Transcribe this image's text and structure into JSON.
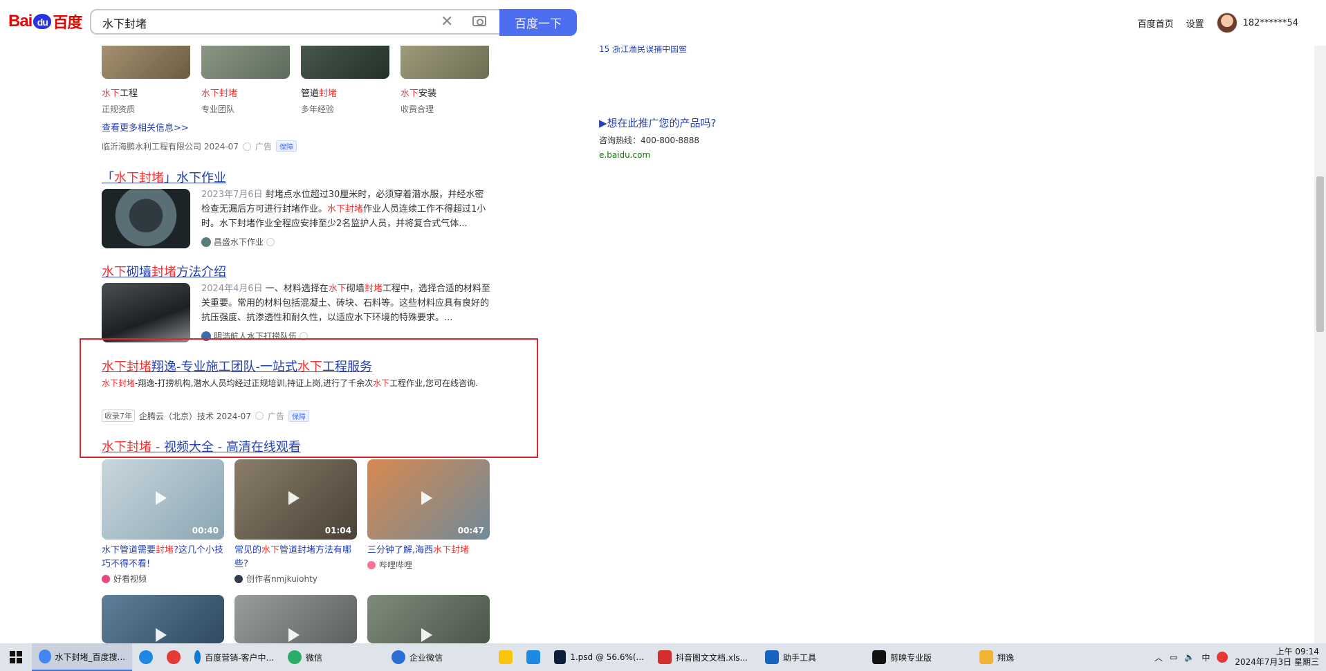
{
  "header": {
    "logo_bai": "Bai",
    "logo_du": "du",
    "logo_cn": "百度",
    "search_value": "水下封堵",
    "search_button": "百度一下",
    "links": [
      "百度首页",
      "设置"
    ],
    "username": "182******54"
  },
  "image_tiles": [
    {
      "title_red": "水下",
      "title_rest": "工程",
      "sub": "正规资质",
      "color": "#8a7a5c"
    },
    {
      "title_red": "水下封堵",
      "title_rest": "",
      "sub": "专业团队",
      "color": "#7e8a78"
    },
    {
      "title_pre": "管道",
      "title_red": "封堵",
      "title_rest": "",
      "sub": "多年经验",
      "color": "#3c4a40"
    },
    {
      "title_red": "水下",
      "title_rest": "安装",
      "sub": "收费合理",
      "color": "#8c8a6a"
    }
  ],
  "more_link": "查看更多相关信息>>",
  "ad1_source": {
    "company": "临沂海鹏水利工程有限公司 2024-07",
    "ad": "广告",
    "badge": "保障"
  },
  "result1": {
    "title_pre": "「",
    "title_red": "水下封堵",
    "title_post": "」水下作业",
    "date": "2023年7月6日",
    "text_a": " 封堵点水位超过30厘米时，必须穿着潜水服，并经水密检查无漏后方可进行封堵作业。",
    "text_red": "水下封堵",
    "text_b": "作业人员连续工作不得超过1小时。水下封堵作业全程应安排至少2名监护人员，并将复合式气体...",
    "source": "昌盛水下作业"
  },
  "result2": {
    "title_red1": "水下",
    "title_mid": "砌墙",
    "title_red2": "封堵",
    "title_post": "方法介绍",
    "date": "2024年4月6日",
    "text_a": " 一、材料选择在",
    "text_red1": "水下",
    "text_b": "砌墙",
    "text_red2": "封堵",
    "text_c": "工程中，选择合适的材料至关重要。常用的材料包括混凝土、砖块、石料等。这些材料应具有良好的抗压强度、抗渗透性和耐久性，以适应水下环境的特殊要求。...",
    "source": "明浩航人水下打捞队伍"
  },
  "ad2": {
    "title_red1": "水下封堵",
    "title_mid": "翔逸-专业施工团队-一站式",
    "title_red2": "水下",
    "title_post": "工程服务",
    "desc_red": "水下封堵",
    "desc_a": "-翔逸-打捞机构,潜水人员均经过正规培训,持证上岗,进行了千余次",
    "desc_red2": "水下",
    "desc_b": "工程作业,您可在线咨询.",
    "tag": "收录7年",
    "company": "企腾云（北京）技术 2024-07",
    "ad": "广告",
    "badge": "保障"
  },
  "video_section": {
    "title_red": "水下封堵",
    "title_post": " - 视频大全 - 高清在线观看"
  },
  "videos": [
    {
      "duration": "00:40",
      "t_a": "水下管道需要",
      "t_red": "封堵",
      "t_b": "?这几个小技巧不得不看!",
      "source": "好看视频",
      "color": "#9fb4c0",
      "scolor": "#e84a7f"
    },
    {
      "duration": "01:04",
      "t_a": "常见的",
      "t_red": "水下",
      "t_b": "管道封堵方法有哪些?",
      "source": "创作者nmjkuiohty",
      "color": "#6b6052",
      "scolor": "#333a48"
    },
    {
      "duration": "00:47",
      "t_a": "三分钟了解,海西",
      "t_red": "水下封堵",
      "t_b": "",
      "source": "哔哩哔哩",
      "color": "#c67a4a",
      "scolor": "#fb7299"
    },
    {
      "color": "#4f6f8a"
    },
    {
      "color": "#8a8f8c"
    },
    {
      "color": "#6d7a6a"
    }
  ],
  "right": {
    "cut_text": "15  浙江渔民误捕中国鲎",
    "promo_title": "▶想在此推广您的产品吗?",
    "promo_phone": "咨询热线：400-800-8888",
    "promo_url": "e.baidu.com"
  },
  "taskbar": {
    "items": [
      {
        "label": "水下封堵_百度搜...",
        "color": "#4285f4",
        "active": true
      },
      {
        "label": "",
        "color": "#1e88e5"
      },
      {
        "label": "",
        "color": "#e53935"
      },
      {
        "label": "百度营销-客户中...",
        "color": "#0a7cd8"
      },
      {
        "label": "微信",
        "color": "#2aae67"
      },
      {
        "label": "企业微信",
        "color": "#2b6fd6"
      },
      {
        "label": "",
        "color": "#f9c511"
      },
      {
        "label": "",
        "color": "#1e88e5"
      },
      {
        "label": "1.psd @ 56.6%(...",
        "color": "#0b1f3a"
      },
      {
        "label": "抖音图文文档.xls...",
        "color": "#d32f2f"
      },
      {
        "label": "助手工具",
        "color": "#1565c0"
      },
      {
        "label": "剪映专业版",
        "color": "#111111"
      },
      {
        "label": "翔逸",
        "color": "#f2b233"
      }
    ],
    "ime": "中",
    "time": "上午 09:14",
    "date": "2024年7月3日 星期三"
  }
}
